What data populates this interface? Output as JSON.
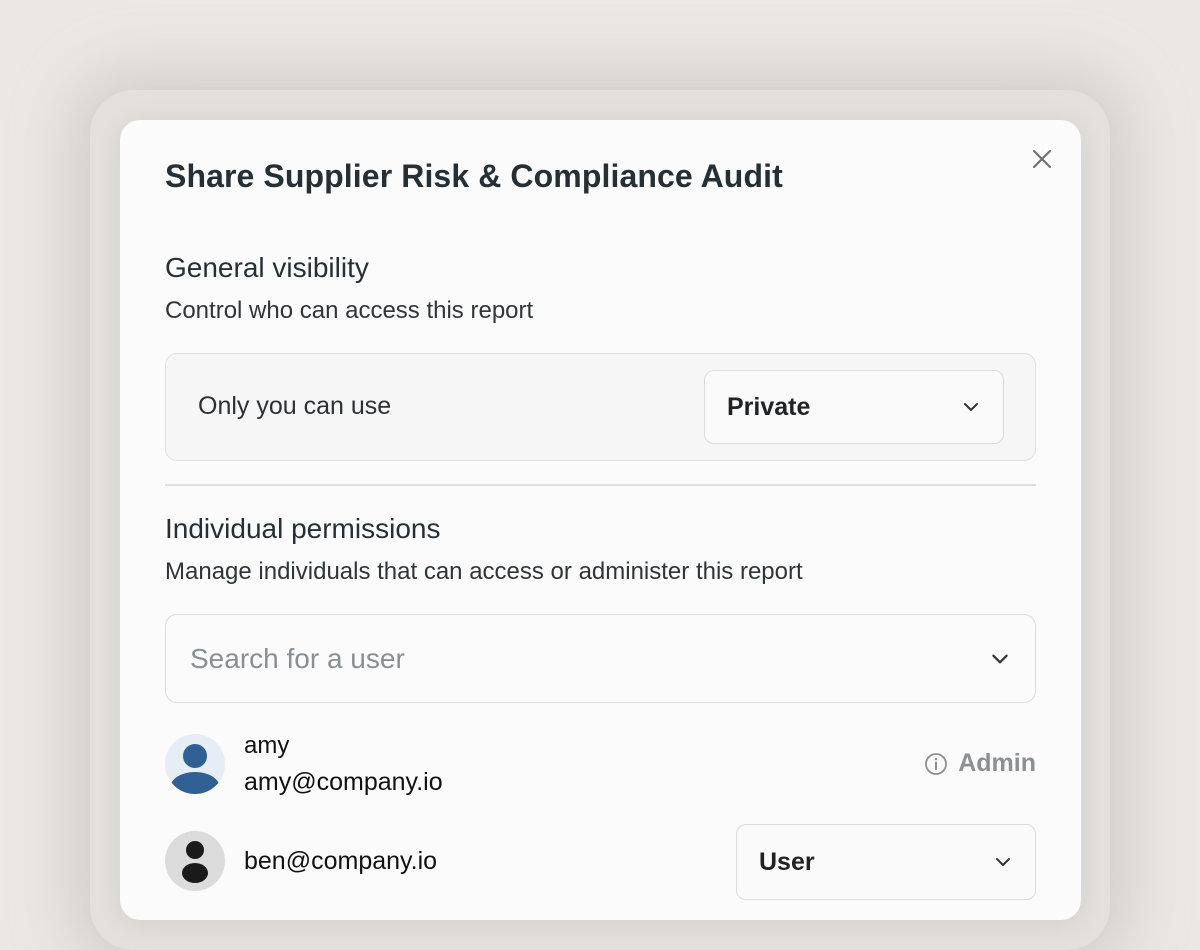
{
  "dialog": {
    "title": "Share Supplier Risk & Compliance Audit"
  },
  "general_visibility": {
    "heading": "General visibility",
    "description": "Control who can access this report",
    "current_label": "Only you can use",
    "select_value": "Private"
  },
  "individual_permissions": {
    "heading": "Individual permissions",
    "description": "Manage individuals that can access or administer this report",
    "search_placeholder": "Search for a user"
  },
  "users": [
    {
      "name": "amy",
      "email": "amy@company.io",
      "role": "Admin",
      "avatar_color": "#2f5f93",
      "avatar_bg": "#e6edf4"
    },
    {
      "email": "ben@company.io",
      "role": "User",
      "avatar_color": "#1a1a1a",
      "avatar_bg": "#dcdcdc"
    }
  ],
  "icons": {
    "close": "close-icon",
    "chevron": "chevron-down-icon",
    "info": "info-icon",
    "avatar": "user-avatar-icon"
  }
}
